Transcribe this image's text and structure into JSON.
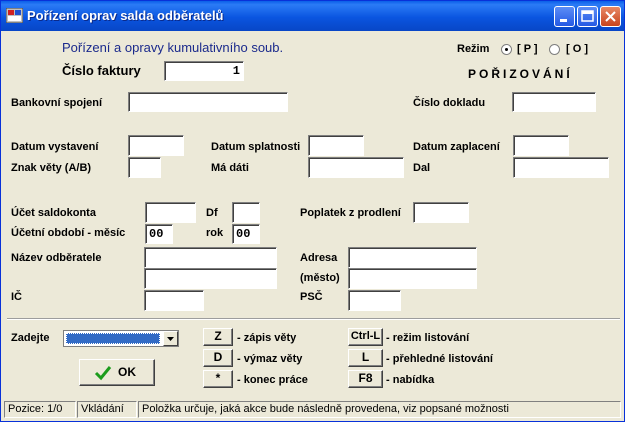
{
  "window": {
    "title": "Pořízení oprav salda odběratelů"
  },
  "header": {
    "subtitle": "Pořízení a opravy kumulativního soub.",
    "invoice_label": "Číslo faktury",
    "invoice_value": "1"
  },
  "mode": {
    "label": "Režim",
    "option_p": "[ P ]",
    "option_o": "[ O ]",
    "state": "POŘIZOVÁNÍ"
  },
  "fields": {
    "bank": {
      "label": "Bankovní spojení",
      "value": ""
    },
    "doc_number": {
      "label": "Číslo dokladu",
      "value": ""
    },
    "issue_date": {
      "label": "Datum vystavení",
      "value": ""
    },
    "due_date": {
      "label": "Datum splatnosti",
      "value": ""
    },
    "paid_date": {
      "label": "Datum zaplacení",
      "value": ""
    },
    "sentence_mark": {
      "label": "Znak věty (A/B)",
      "value": ""
    },
    "debit": {
      "label": "Má dáti",
      "value": ""
    },
    "credit": {
      "label": "Dal",
      "value": ""
    },
    "account": {
      "label": "Účet saldokonta",
      "value": ""
    },
    "df": {
      "label": "Df",
      "value": ""
    },
    "late_fee": {
      "label": "Poplatek z prodlení",
      "value": ""
    },
    "period_month": {
      "label": "Účetní období - měsíc",
      "value": "00"
    },
    "period_year": {
      "label": "rok",
      "value": "00"
    },
    "customer_name": {
      "label": "Název odběratele",
      "value": "",
      "value2": ""
    },
    "address": {
      "label": "Adresa",
      "value": ""
    },
    "city": {
      "label": "(město)",
      "value": ""
    },
    "ic": {
      "label": "IČ",
      "value": ""
    },
    "psc": {
      "label": "PSČ",
      "value": ""
    }
  },
  "actions": {
    "enter_label": "Zadejte",
    "ok_label": "OK",
    "write_key": "Z",
    "write_desc": "- zápis věty",
    "delete_key": "D",
    "delete_desc": "- výmaz věty",
    "end_key": "*",
    "end_desc": "- konec práce",
    "list_key": "Ctrl-L",
    "list_desc": "- režim listování",
    "overview_key": "L",
    "overview_desc": "- přehledné listování",
    "menu_key": "F8",
    "menu_desc": "- nabídka"
  },
  "status": {
    "position": "Pozice: 1/0",
    "mode": "Vkládání",
    "hint": "Položka určuje, jaká akce bude následně provedena, viz popsané možnosti"
  },
  "colors": {
    "title_bar": "#0a55e0",
    "header_text": "#1b2a8c",
    "selection": "#316ac5"
  }
}
